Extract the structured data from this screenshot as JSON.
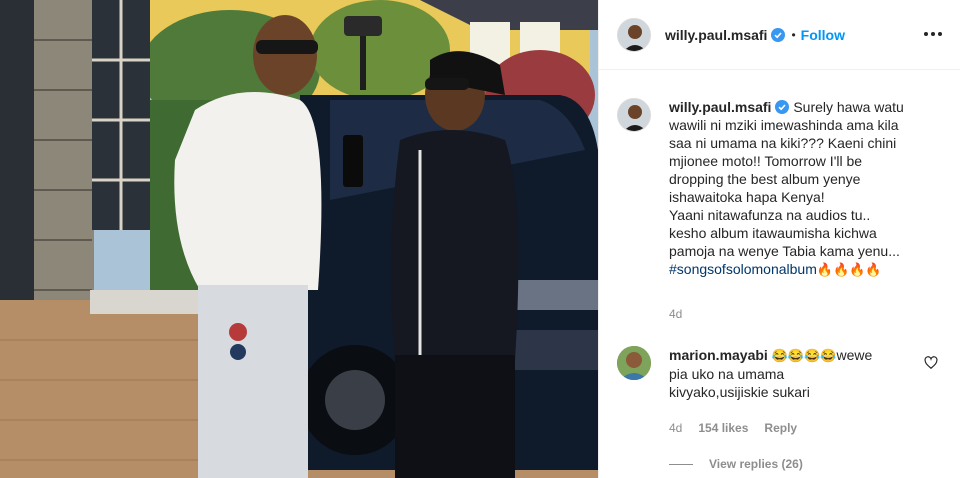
{
  "post": {
    "username": "willy.paul.msafi",
    "verified_icon": "verified-badge-icon",
    "separator": "•",
    "follow_label": "Follow",
    "more_icon": "more-options-icon"
  },
  "caption": {
    "username": "willy.paul.msafi",
    "lines": [
      "Surely hawa watu",
      "wawili ni mziki imewashinda ama kila",
      "saa ni umama na kiki??? Kaeni chini",
      "mjionee moto!! Tomorrow I'll be",
      "dropping the best album yenye",
      "ishawaitoka hapa Kenya!",
      "Yaani nitawafunza na audios tu..",
      "kesho album itawaumisha kichwa",
      "pamoja na wenye Tabia kama yenu..."
    ],
    "hashtag": "#songsofsolomonalbum",
    "hashtag_emojis": "🔥🔥🔥🔥",
    "time": "4d"
  },
  "comment": {
    "username": "marion.mayabi",
    "emojis": "😂😂😂😂",
    "text_part1": "wewe",
    "text_part2": "pia uko na umama",
    "text_part3": "kivyako,usijiskie sukari",
    "time": "4d",
    "likes": "154 likes",
    "reply_label": "Reply",
    "view_replies": "View replies (26)",
    "heart_icon": "heart-outline-icon"
  },
  "colors": {
    "link_blue": "#0095f6",
    "hashtag": "#00376b",
    "muted": "#8e8e8e",
    "text": "#262626"
  }
}
